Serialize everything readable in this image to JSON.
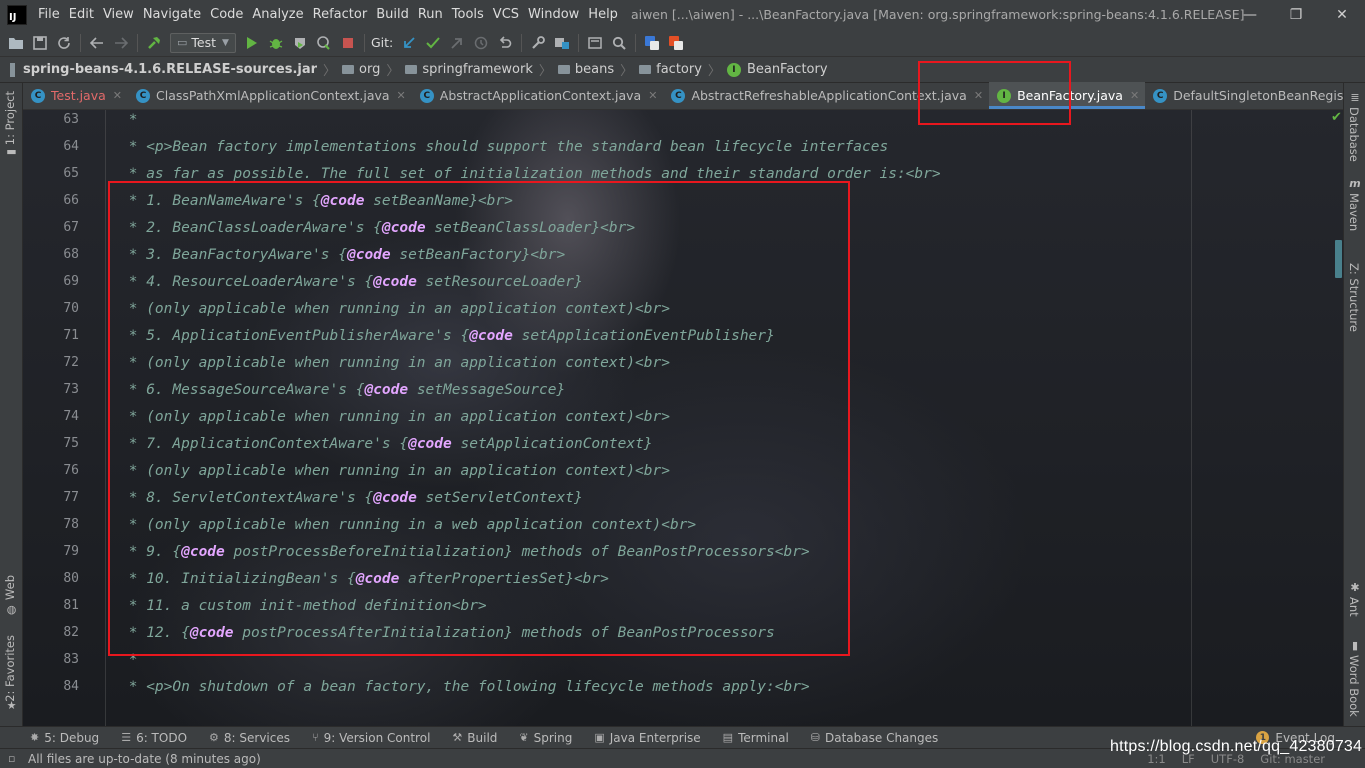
{
  "menubar": {
    "logo_text": "IJ",
    "items": [
      "File",
      "Edit",
      "View",
      "Navigate",
      "Code",
      "Analyze",
      "Refactor",
      "Build",
      "Run",
      "Tools",
      "VCS",
      "Window",
      "Help"
    ],
    "window_title": "aiwen [...\\aiwen] - ...\\BeanFactory.java [Maven: org.springframework:spring-beans:4.1.6.RELEASE]",
    "controls": {
      "minimize": "—",
      "maximize": "❐",
      "close": "✕"
    }
  },
  "toolbar": {
    "run_config_label": "Test",
    "git_label": "Git:"
  },
  "breadcrumb": {
    "root": "spring-beans-4.1.6.RELEASE-sources.jar",
    "items": [
      "org",
      "springframework",
      "beans",
      "factory",
      "BeanFactory"
    ]
  },
  "tabs": [
    {
      "label": "Test.java",
      "kind": "test"
    },
    {
      "label": "ClassPathXmlApplicationContext.java",
      "kind": "class"
    },
    {
      "label": "AbstractApplicationContext.java",
      "kind": "class"
    },
    {
      "label": "AbstractRefreshableApplicationContext.java",
      "kind": "class"
    },
    {
      "label": "BeanFactory.java",
      "kind": "interface",
      "active": true
    },
    {
      "label": "DefaultSingletonBeanRegistry.java",
      "kind": "class"
    }
  ],
  "tabs_overflow": "≡4",
  "left_tools": {
    "project": "1: Project",
    "web": "Web",
    "favorites": "2: Favorites"
  },
  "right_tools": {
    "database": "Database",
    "maven": "Maven",
    "structure": "Z: Structure",
    "ant": "Ant",
    "word_book": "Word Book"
  },
  "editor": {
    "lines": [
      {
        "n": "63",
        "segments": [
          {
            "t": " *"
          }
        ]
      },
      {
        "n": "64",
        "segments": [
          {
            "t": " * <p>Bean factory implementations should support the standard bean lifecycle interfaces"
          }
        ]
      },
      {
        "n": "65",
        "segments": [
          {
            "t": " * as far as possible. The full set of initialization methods and their standard order is:<br>"
          }
        ]
      },
      {
        "n": "66",
        "segments": [
          {
            "t": " * 1. BeanNameAware's {"
          },
          {
            "t": "@code",
            "tag": true
          },
          {
            "t": " setBeanName}<br>"
          }
        ]
      },
      {
        "n": "67",
        "segments": [
          {
            "t": " * 2. BeanClassLoaderAware's {"
          },
          {
            "t": "@code",
            "tag": true
          },
          {
            "t": " setBeanClassLoader}<br>"
          }
        ]
      },
      {
        "n": "68",
        "segments": [
          {
            "t": " * 3. BeanFactoryAware's {"
          },
          {
            "t": "@code",
            "tag": true
          },
          {
            "t": " setBeanFactory}<br>"
          }
        ]
      },
      {
        "n": "69",
        "segments": [
          {
            "t": " * 4. ResourceLoaderAware's {"
          },
          {
            "t": "@code",
            "tag": true
          },
          {
            "t": " setResourceLoader}"
          }
        ]
      },
      {
        "n": "70",
        "segments": [
          {
            "t": " * (only applicable when running in an application context)<br>"
          }
        ]
      },
      {
        "n": "71",
        "segments": [
          {
            "t": " * 5. ApplicationEventPublisherAware's {"
          },
          {
            "t": "@code",
            "tag": true
          },
          {
            "t": " setApplicationEventPublisher}"
          }
        ]
      },
      {
        "n": "72",
        "segments": [
          {
            "t": " * (only applicable when running in an application context)<br>"
          }
        ]
      },
      {
        "n": "73",
        "segments": [
          {
            "t": " * 6. MessageSourceAware's {"
          },
          {
            "t": "@code",
            "tag": true
          },
          {
            "t": " setMessageSource}"
          }
        ]
      },
      {
        "n": "74",
        "segments": [
          {
            "t": " * (only applicable when running in an application context)<br>"
          }
        ]
      },
      {
        "n": "75",
        "segments": [
          {
            "t": " * 7. ApplicationContextAware's {"
          },
          {
            "t": "@code",
            "tag": true
          },
          {
            "t": " setApplicationContext}"
          }
        ]
      },
      {
        "n": "76",
        "segments": [
          {
            "t": " * (only applicable when running in an application context)<br>"
          }
        ]
      },
      {
        "n": "77",
        "segments": [
          {
            "t": " * 8. ServletContextAware's {"
          },
          {
            "t": "@code",
            "tag": true
          },
          {
            "t": " setServletContext}"
          }
        ]
      },
      {
        "n": "78",
        "segments": [
          {
            "t": " * (only applicable when running in a web application context)<br>"
          }
        ]
      },
      {
        "n": "79",
        "segments": [
          {
            "t": " * 9. {"
          },
          {
            "t": "@code",
            "tag": true
          },
          {
            "t": " postProcessBeforeInitialization} methods of BeanPostProcessors<br>"
          }
        ]
      },
      {
        "n": "80",
        "segments": [
          {
            "t": " * 10. InitializingBean's {"
          },
          {
            "t": "@code",
            "tag": true
          },
          {
            "t": " afterPropertiesSet}<br>"
          }
        ]
      },
      {
        "n": "81",
        "segments": [
          {
            "t": " * 11. a custom init-method definition<br>"
          }
        ]
      },
      {
        "n": "82",
        "segments": [
          {
            "t": " * 12. {"
          },
          {
            "t": "@code",
            "tag": true
          },
          {
            "t": " postProcessAfterInitialization} methods of BeanPostProcessors"
          }
        ]
      },
      {
        "n": "83",
        "segments": [
          {
            "t": " *"
          }
        ]
      },
      {
        "n": "84",
        "segments": [
          {
            "t": " * <p>On shutdown of a bean factory, the following lifecycle methods apply:<br>"
          }
        ]
      }
    ]
  },
  "bottom_tools": [
    {
      "label": "5: Debug",
      "icon": "bug-icon"
    },
    {
      "label": "6: TODO",
      "icon": "list-icon"
    },
    {
      "label": "8: Services",
      "icon": "services-icon"
    },
    {
      "label": "9: Version Control",
      "icon": "branch-icon"
    },
    {
      "label": "Build",
      "icon": "hammer-icon"
    },
    {
      "label": "Spring",
      "icon": "leaf-icon"
    },
    {
      "label": "Java Enterprise",
      "icon": "enterprise-icon"
    },
    {
      "label": "Terminal",
      "icon": "terminal-icon"
    },
    {
      "label": "Database Changes",
      "icon": "database-changes-icon"
    }
  ],
  "event_log": {
    "count": "1",
    "label": "Event Log"
  },
  "status": {
    "text": "All files are up-to-date (8 minutes ago)",
    "position": "1:1",
    "line_sep": "LF",
    "encoding": "UTF-8",
    "git_branch": "Git: master"
  },
  "watermark": "https://blog.csdn.net/qq_42380734",
  "colors": {
    "comment": "#7fa69a",
    "doc_tag": "#e3a6ff",
    "highlight_box": "#e8171e",
    "active_tab_underline": "#4a88c7"
  }
}
